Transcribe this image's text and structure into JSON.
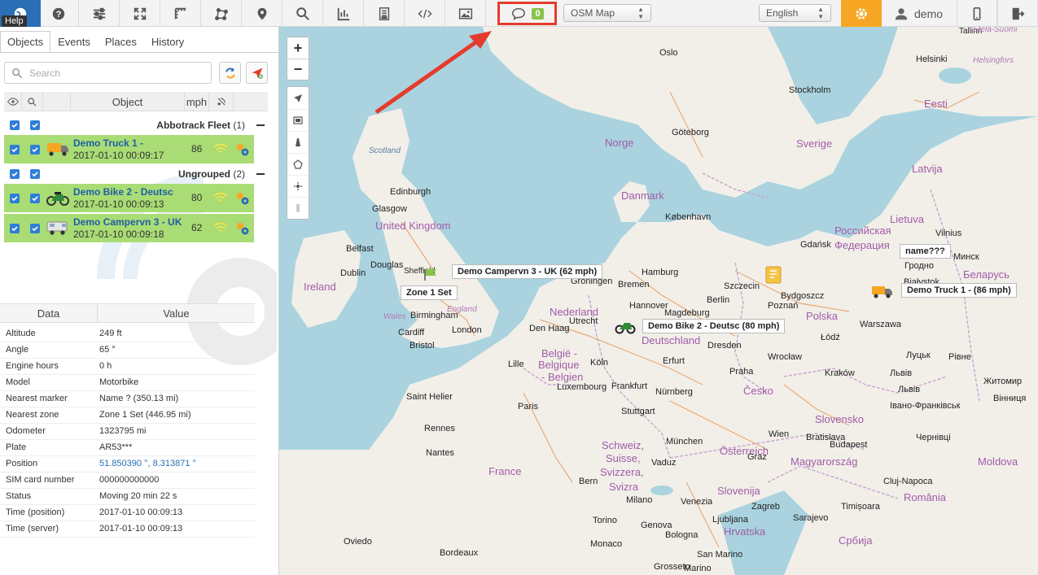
{
  "toolbar": {
    "help_tooltip": "Help",
    "icons": [
      "globe-icon",
      "help-icon",
      "sliders-icon",
      "fullscreen-icon",
      "ruler-icon",
      "polygon-icon",
      "marker-icon",
      "search-icon",
      "chart-icon",
      "report-icon",
      "code-icon",
      "image-icon"
    ],
    "chat_count": "0",
    "map_type": "OSM Map",
    "language": "English",
    "user": "demo"
  },
  "sidebar": {
    "tabs": [
      "Objects",
      "Events",
      "Places",
      "History"
    ],
    "search_placeholder": "Search",
    "columns": {
      "object": "Object",
      "speed": "mph"
    },
    "groups": [
      {
        "name": "Abbotrack Fleet",
        "count": "(1)"
      },
      {
        "name": "Ungrouped",
        "count": "(2)"
      }
    ],
    "objects": [
      {
        "name": "Demo Truck 1 -",
        "time": "2017-01-10 00:09:17",
        "speed": "86"
      },
      {
        "name": "Demo Bike 2 - Deutsc",
        "time": "2017-01-10 00:09:13",
        "speed": "80"
      },
      {
        "name": "Demo Campervn 3 - UK",
        "time": "2017-01-10 00:09:18",
        "speed": "62"
      }
    ],
    "data_table": {
      "headers": {
        "key": "Data",
        "value": "Value"
      },
      "rows": [
        {
          "key": "Altitude",
          "value": "249 ft"
        },
        {
          "key": "Angle",
          "value": "65 °"
        },
        {
          "key": "Engine hours",
          "value": "0 h"
        },
        {
          "key": "Model",
          "value": "Motorbike"
        },
        {
          "key": "Nearest marker",
          "value": "Name ? (350.13 mi)"
        },
        {
          "key": "Nearest zone",
          "value": "Zone 1 Set  (446.95 mi)"
        },
        {
          "key": "Odometer",
          "value": "1323795 mi"
        },
        {
          "key": "Plate",
          "value": "AR53***"
        },
        {
          "key": "Position",
          "value": "51.850390 °, 8.313871 °"
        },
        {
          "key": "SIM card number",
          "value": "000000000000"
        },
        {
          "key": "Status",
          "value": "Moving 20 min 22 s"
        },
        {
          "key": "Time (position)",
          "value": "2017-01-10 00:09:13"
        },
        {
          "key": "Time (server)",
          "value": "2017-01-10 00:09:13"
        }
      ]
    }
  },
  "map": {
    "markers": {
      "truck": "Demo Truck 1 - (86 mph)",
      "bike": "Demo Bike 2 - Deutsc (80 mph)",
      "camper": "Demo Campervn 3 - UK (62 mph)",
      "zone": "Zone 1 Set",
      "place": "name???"
    },
    "cities": {
      "oslo": "Oslo",
      "helsinki": "Helsinki",
      "stockholm": "Stockholm",
      "goteborg": "Göteborg",
      "edinburgh": "Edinburgh",
      "glasgow": "Glasgow",
      "kobenhavn": "København",
      "belfast": "Belfast",
      "douglas": "Douglas",
      "dublin": "Dublin",
      "hamburg": "Hamburg",
      "bremen": "Bremen",
      "groningen": "Groningen",
      "hannover": "Hannover",
      "szczecin": "Szczecin",
      "berlin": "Berlin",
      "magdeburg": "Magdeburg",
      "birmingham": "Birmingham",
      "london": "London",
      "cardiff": "Cardiff",
      "bristol": "Bristol",
      "denhaag": "Den Haag",
      "utrecht": "Utrecht",
      "lille": "Lille",
      "koln": "Köln",
      "erfurt": "Erfurt",
      "dresden": "Dresden",
      "warszawa": "Warszawa",
      "poznan": "Poznań",
      "bydgoszcz": "Bydgoszcz",
      "gdansk": "Gdańsk",
      "lodz": "Łódź",
      "wroclaw": "Wrocław",
      "praha": "Praha",
      "krakow": "Kraków",
      "frankfurt": "Frankfurt",
      "nurnberg": "Nürnberg",
      "stuttgart": "Stuttgart",
      "paris": "Paris",
      "luxembourg": "Luxembourg",
      "rennes": "Rennes",
      "nantes": "Nantes",
      "munchen": "München",
      "wien": "Wien",
      "bratislava": "Bratislava",
      "budapest": "Budapest",
      "bern": "Bern",
      "vaduz": "Vaduz",
      "graz": "Graz",
      "milano": "Milano",
      "venezia": "Venezia",
      "zagreb": "Zagreb",
      "ljubljana": "Ljubljana",
      "torino": "Torino",
      "genova": "Genova",
      "bologna": "Bologna",
      "bordeaux": "Bordeaux",
      "monaco": "Monaco",
      "oviedo": "Oviedo",
      "sarajevo": "Sarajevo",
      "timisoara": "Timișoara",
      "cluj": "Cluj-Napoca",
      "vilnius": "Vilnius",
      "minsk": "Минск",
      "grodno": "Гродно",
      "bialystok": "Białystok",
      "lviv": "Львів",
      "rivne": "Рівне",
      "lutsk": "Луцьк",
      "zhytomyr": "Житомир",
      "vinnytsia": "Вінниця",
      "chernivtsi": "Чернівці",
      "ivano": "Івано-Франківськ",
      "tallinn": "Tallinn",
      "saint_helier": "Saint Helier",
      "sheffield": "Sheffield",
      "san_marino": "San Marino",
      "marino": "Marino",
      "grosseto": "Grosseto"
    },
    "countries": {
      "norge": "Norge",
      "sverige": "Sverige",
      "danmark": "Danmark",
      "latvija": "Latvija",
      "eesti": "Eesti",
      "lietuva": "Lietuva",
      "scotland": "Scotland",
      "uk": "United Kingdom",
      "ireland": "Ireland",
      "nederland": "Nederland",
      "belgie": "België -",
      "belgique": "Belgique",
      "belgien": "- Belgien",
      "deutschland": "Deutschland",
      "polska": "Polska",
      "cesko": "Česko",
      "slovensko": "Slovensko",
      "france": "France",
      "schweiz": "Schweiz,",
      "suisse": "Suisse,",
      "svizzera": "Svizzera,",
      "svizra": "Svizra",
      "osterreich": "Österreich",
      "magyarorszag": "Magyarország",
      "slovenija": "Slovenija",
      "hrvatska": "Hrvatska",
      "romania": "România",
      "srbija": "Србија",
      "moldova": "Moldova",
      "russia": "Российская",
      "russia2": "Федерация",
      "belarus": "Беларусь",
      "england": "England",
      "wales": "Wales",
      "helsingfors": "Helsingfors",
      "etela_suomi": "Etelä-Suomi"
    }
  }
}
